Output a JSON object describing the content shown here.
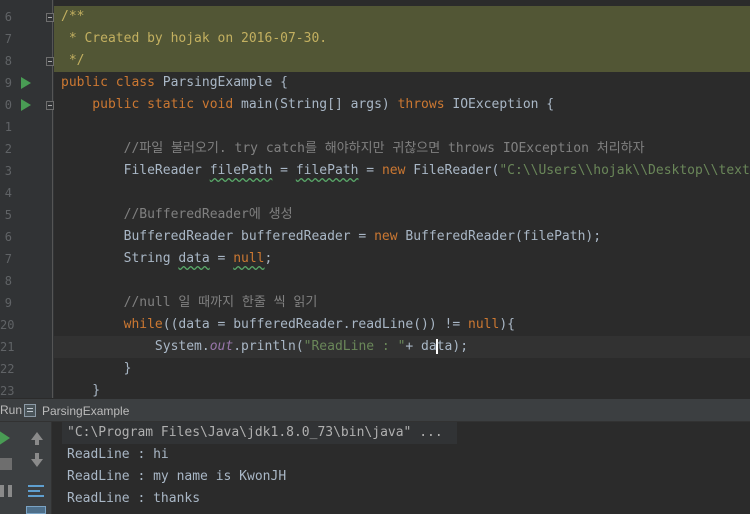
{
  "editor": {
    "lines": [
      {
        "num": "6",
        "segments": [
          {
            "text": "/**",
            "cls": "doc"
          }
        ]
      },
      {
        "num": "7",
        "segments": [
          {
            "text": " * Created by hojak on 2016-07-30.",
            "cls": "doc"
          }
        ]
      },
      {
        "num": "8",
        "segments": [
          {
            "text": " */",
            "cls": "doc"
          }
        ]
      },
      {
        "num": "9",
        "segments": [
          {
            "text": "public ",
            "cls": "kw"
          },
          {
            "text": "class ",
            "cls": "kw"
          },
          {
            "text": "ParsingExample {",
            "cls": ""
          }
        ]
      },
      {
        "num": "0",
        "segments": [
          {
            "text": "    public ",
            "cls": "kw"
          },
          {
            "text": "static ",
            "cls": "kw"
          },
          {
            "text": "void ",
            "cls": "kw"
          },
          {
            "text": "main(String[] args) ",
            "cls": ""
          },
          {
            "text": "throws ",
            "cls": "kw"
          },
          {
            "text": "IOException {",
            "cls": ""
          }
        ]
      },
      {
        "num": "1",
        "segments": [
          {
            "text": "",
            "cls": ""
          }
        ]
      },
      {
        "num": "2",
        "segments": [
          {
            "text": "        //파일 불러오기. try catch를 해야하지만 귀찮으면 throws IOException 처리하자",
            "cls": "com"
          }
        ]
      },
      {
        "num": "3",
        "segments": [
          {
            "text": "        FileReader ",
            "cls": ""
          },
          {
            "text": "filePath",
            "cls": "wav"
          },
          {
            "text": " = ",
            "cls": ""
          },
          {
            "text": "filePath",
            "cls": "wav"
          },
          {
            "text": " = ",
            "cls": ""
          },
          {
            "text": "new ",
            "cls": "kw"
          },
          {
            "text": "FileReader(",
            "cls": ""
          },
          {
            "text": "\"C:\\\\Users\\\\hojak\\\\Desktop\\\\textEX.txt\"",
            "cls": "str"
          },
          {
            "text": ");",
            "cls": ""
          }
        ]
      },
      {
        "num": "4",
        "segments": [
          {
            "text": "",
            "cls": ""
          }
        ]
      },
      {
        "num": "5",
        "segments": [
          {
            "text": "        //BufferedReader에 생성",
            "cls": "com"
          }
        ]
      },
      {
        "num": "6",
        "segments": [
          {
            "text": "        BufferedReader bufferedReader = ",
            "cls": ""
          },
          {
            "text": "new ",
            "cls": "kw"
          },
          {
            "text": "BufferedReader(filePath);",
            "cls": ""
          }
        ]
      },
      {
        "num": "7",
        "segments": [
          {
            "text": "        String ",
            "cls": ""
          },
          {
            "text": "data",
            "cls": "wav"
          },
          {
            "text": " = ",
            "cls": ""
          },
          {
            "text": "null",
            "cls": "kw wav"
          },
          {
            "text": ";",
            "cls": ""
          }
        ]
      },
      {
        "num": "8",
        "segments": [
          {
            "text": "",
            "cls": ""
          }
        ]
      },
      {
        "num": "9",
        "segments": [
          {
            "text": "        //null 일 때까지 한줄 씩 읽기",
            "cls": "com"
          }
        ]
      },
      {
        "num": "20",
        "segments": [
          {
            "text": "        while",
            "cls": "kw"
          },
          {
            "text": "((data = bufferedReader.readLine()) != ",
            "cls": ""
          },
          {
            "text": "null",
            "cls": "kw"
          },
          {
            "text": "){",
            "cls": ""
          }
        ]
      },
      {
        "num": "21",
        "segments": [
          {
            "text": "            System.",
            "cls": ""
          },
          {
            "text": "out",
            "cls": "fld"
          },
          {
            "text": ".println(",
            "cls": ""
          },
          {
            "text": "\"ReadLine : \"",
            "cls": "str"
          },
          {
            "text": "+ da",
            "cls": ""
          },
          {
            "text": "|",
            "cls": "caret"
          },
          {
            "text": "ta);",
            "cls": ""
          }
        ]
      },
      {
        "num": "22",
        "segments": [
          {
            "text": "        }",
            "cls": ""
          }
        ]
      },
      {
        "num": "23",
        "segments": [
          {
            "text": "    }",
            "cls": ""
          }
        ]
      }
    ]
  },
  "run": {
    "label": "Run",
    "tab_label": "ParsingExample",
    "console": {
      "command": "\"C:\\Program Files\\Java\\jdk1.8.0_73\\bin\\java\" ...",
      "outputs": [
        "ReadLine : hi",
        "ReadLine : my name is KwonJH",
        "ReadLine : thanks"
      ]
    }
  }
}
